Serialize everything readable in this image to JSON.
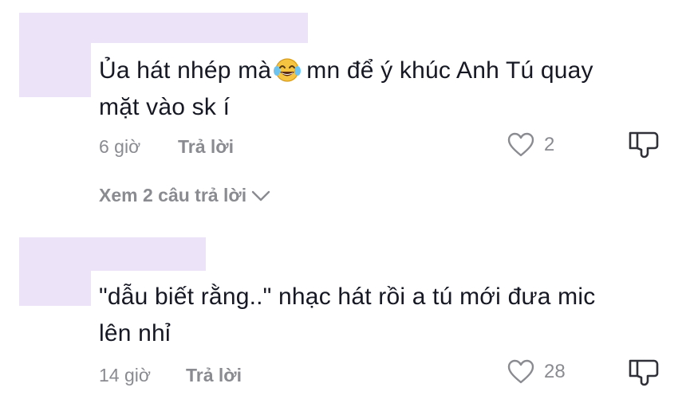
{
  "comments": [
    {
      "text_before_emoji": "Ủa hát nhép mà",
      "emoji": "face-with-tears-of-joy",
      "text_after_emoji": "mn để ý khúc Anh Tú quay",
      "text_line2": "mặt vào sk í",
      "time": "6 giờ",
      "reply_label": "Trả lời",
      "likes": "2",
      "view_replies": "Xem 2 câu trả lời"
    },
    {
      "text_line1": "\"dẫu biết rằng..\" nhạc hát rồi a tú mới đưa mic",
      "text_line2": "lên nhỉ",
      "time": "14 giờ",
      "reply_label": "Trả lời",
      "likes": "28"
    }
  ],
  "colors": {
    "text": "#161823",
    "meta": "#8a8b91",
    "redaction": "#ede3f8"
  },
  "icons": [
    "heart-outline-icon",
    "thumbs-down-icon",
    "chevron-down-icon"
  ]
}
